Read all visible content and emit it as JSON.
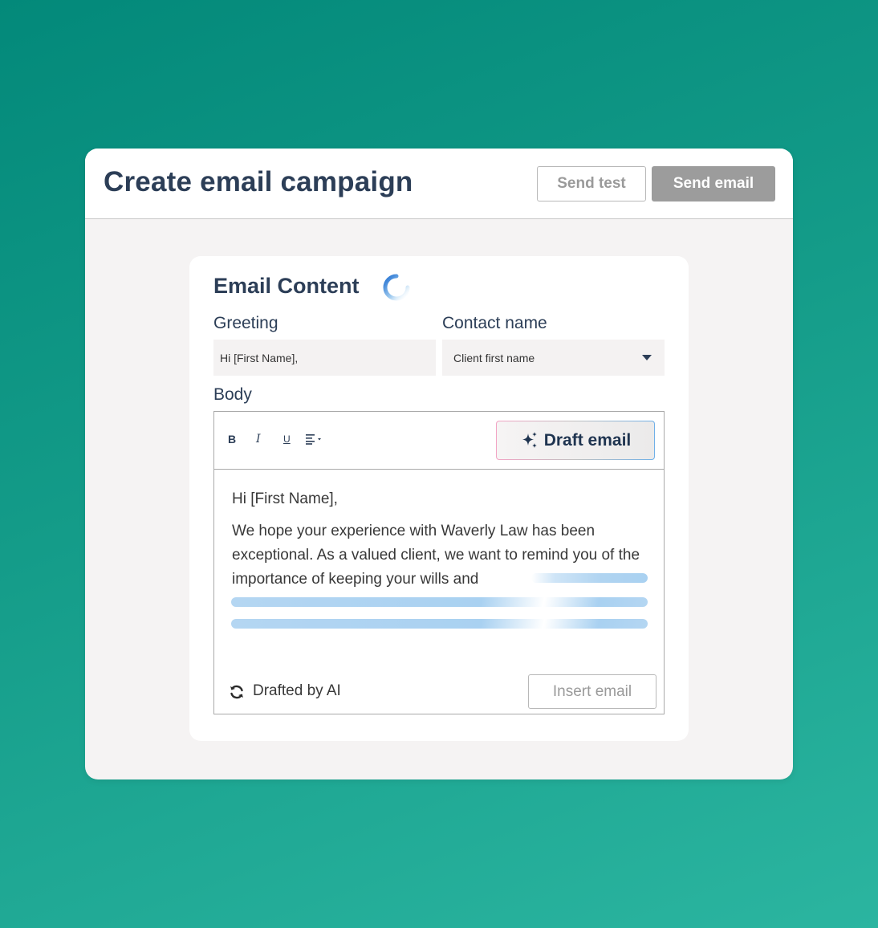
{
  "header": {
    "title": "Create email campaign",
    "send_test_label": "Send test",
    "send_email_label": "Send email"
  },
  "card": {
    "title": "Email Content",
    "greeting_label": "Greeting",
    "greeting_value": "Hi [First Name],",
    "contact_label": "Contact name",
    "contact_value": "Client first name",
    "body_label": "Body"
  },
  "toolbar": {
    "bold": "B",
    "italic": "I",
    "underline": "U",
    "draft_label": "Draft email"
  },
  "editor": {
    "greeting": "Hi [First Name],",
    "paragraph": "We hope your experience with Waverly Law has been exceptional. As a valued client, we want to remind you of the importance of keeping your wills and",
    "drafted_label": "Drafted by AI",
    "insert_label": "Insert email"
  },
  "colors": {
    "background_start": "#03897a",
    "background_end": "#2bb5a0",
    "title_text": "#2c3e57",
    "send_email_bg": "#9c9c9c",
    "skeleton": "#a9d1f1"
  },
  "icons": [
    "spinner-icon",
    "sparkle-icon",
    "align-icon",
    "refresh-icon",
    "chevron-down-icon"
  ]
}
